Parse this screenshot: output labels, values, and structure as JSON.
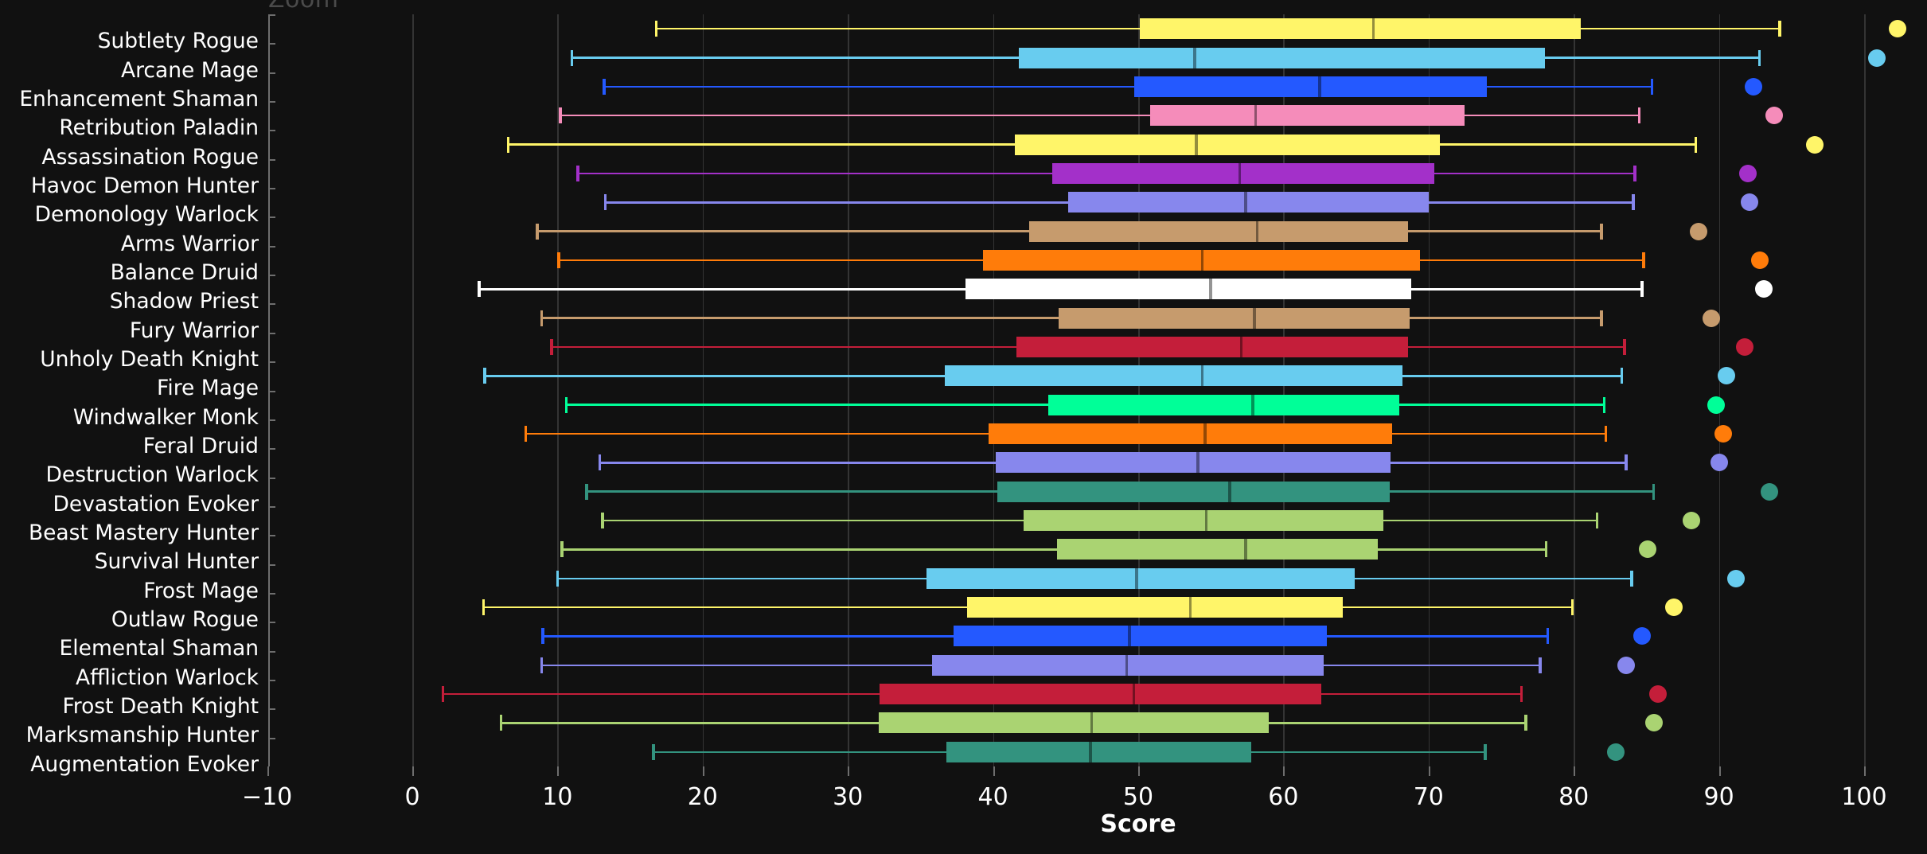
{
  "overlay": {
    "zoom_label": "Zoom"
  },
  "chart_data": {
    "type": "box",
    "title": "",
    "xlabel": "Score",
    "ylabel": "",
    "xlim": [
      -10,
      100
    ],
    "xticks": [
      -10,
      0,
      10,
      20,
      30,
      40,
      50,
      60,
      70,
      80,
      90,
      100
    ],
    "xticklabels": [
      "−10",
      "0",
      "10",
      "20",
      "30",
      "40",
      "50",
      "60",
      "70",
      "80",
      "90",
      "100"
    ],
    "grid": true,
    "grid_axis": "x",
    "legend": "none",
    "background": "#111111",
    "categories": [
      "Subtlety Rogue",
      "Arcane Mage",
      "Enhancement Shaman",
      "Retribution Paladin",
      "Assassination Rogue",
      "Havoc Demon Hunter",
      "Demonology Warlock",
      "Arms Warrior",
      "Balance Druid",
      "Shadow Priest",
      "Fury Warrior",
      "Unholy Death Knight",
      "Fire Mage",
      "Windwalker Monk",
      "Feral Druid",
      "Destruction Warlock",
      "Devastation Evoker",
      "Beast Mastery Hunter",
      "Survival Hunter",
      "Frost Mage",
      "Outlaw Rogue",
      "Elemental Shaman",
      "Affliction Warlock",
      "Frost Death Knight",
      "Marksmanship Hunter",
      "Augmentation Evoker"
    ],
    "boxes": [
      {
        "label": "Subtlety Rogue",
        "color": "#FFF569",
        "whisker_low": 16.8,
        "q1": 50.1,
        "median": 66.2,
        "q3": 80.5,
        "whisker_high": 94.2,
        "outliers": [
          102.3
        ]
      },
      {
        "label": "Arcane Mage",
        "color": "#68CCEF",
        "whisker_low": 11.0,
        "q1": 41.8,
        "median": 53.9,
        "q3": 78.0,
        "whisker_high": 92.8,
        "outliers": [
          100.9
        ]
      },
      {
        "label": "Enhancement Shaman",
        "color": "#2459FF",
        "whisker_low": 13.2,
        "q1": 49.7,
        "median": 62.5,
        "q3": 74.0,
        "whisker_high": 85.4,
        "outliers": [
          92.4
        ]
      },
      {
        "label": "Retribution Paladin",
        "color": "#F58CBA",
        "whisker_low": 10.2,
        "q1": 50.8,
        "median": 58.1,
        "q3": 72.5,
        "whisker_high": 84.5,
        "outliers": [
          93.8
        ]
      },
      {
        "label": "Assassination Rogue",
        "color": "#FFF569",
        "whisker_low": 6.6,
        "q1": 41.5,
        "median": 54.0,
        "q3": 70.8,
        "whisker_high": 88.4,
        "outliers": [
          96.6
        ]
      },
      {
        "label": "Havoc Demon Hunter",
        "color": "#A330C9",
        "whisker_low": 11.4,
        "q1": 44.1,
        "median": 57.0,
        "q3": 70.4,
        "whisker_high": 84.2,
        "outliers": [
          92.0
        ]
      },
      {
        "label": "Demonology Warlock",
        "color": "#8787ED",
        "whisker_low": 13.3,
        "q1": 45.2,
        "median": 57.4,
        "q3": 70.0,
        "whisker_high": 84.1,
        "outliers": [
          92.1
        ]
      },
      {
        "label": "Arms Warrior",
        "color": "#C69B6D",
        "whisker_low": 8.6,
        "q1": 42.5,
        "median": 58.2,
        "q3": 68.6,
        "whisker_high": 81.9,
        "outliers": [
          88.6
        ]
      },
      {
        "label": "Balance Druid",
        "color": "#FF7C0A",
        "whisker_low": 10.1,
        "q1": 39.3,
        "median": 54.4,
        "q3": 69.4,
        "whisker_high": 84.8,
        "outliers": [
          92.8
        ]
      },
      {
        "label": "Shadow Priest",
        "color": "#FFFFFF",
        "whisker_low": 4.6,
        "q1": 38.1,
        "median": 55.0,
        "q3": 68.8,
        "whisker_high": 84.7,
        "outliers": [
          93.1
        ]
      },
      {
        "label": "Fury Warrior",
        "color": "#C69B6D",
        "whisker_low": 8.9,
        "q1": 44.5,
        "median": 58.0,
        "q3": 68.7,
        "whisker_high": 81.9,
        "outliers": [
          89.5
        ]
      },
      {
        "label": "Unholy Death Knight",
        "color": "#C41E3A",
        "whisker_low": 9.6,
        "q1": 41.6,
        "median": 57.1,
        "q3": 68.6,
        "whisker_high": 83.5,
        "outliers": [
          91.8
        ]
      },
      {
        "label": "Fire Mage",
        "color": "#68CCEF",
        "whisker_low": 5.0,
        "q1": 36.7,
        "median": 54.4,
        "q3": 68.2,
        "whisker_high": 83.3,
        "outliers": [
          90.5
        ]
      },
      {
        "label": "Windwalker Monk",
        "color": "#00FF98",
        "whisker_low": 10.6,
        "q1": 43.8,
        "median": 57.9,
        "q3": 68.0,
        "whisker_high": 82.1,
        "outliers": [
          89.8
        ]
      },
      {
        "label": "Feral Druid",
        "color": "#FF7C0A",
        "whisker_low": 7.8,
        "q1": 39.7,
        "median": 54.6,
        "q3": 67.5,
        "whisker_high": 82.2,
        "outliers": [
          90.3
        ]
      },
      {
        "label": "Destruction Warlock",
        "color": "#8787ED",
        "whisker_low": 12.9,
        "q1": 40.2,
        "median": 54.1,
        "q3": 67.4,
        "whisker_high": 83.6,
        "outliers": [
          90.0
        ]
      },
      {
        "label": "Devastation Evoker",
        "color": "#33937F",
        "whisker_low": 12.0,
        "q1": 40.3,
        "median": 56.3,
        "q3": 67.3,
        "whisker_high": 85.5,
        "outliers": [
          93.5
        ]
      },
      {
        "label": "Beast Mastery Hunter",
        "color": "#AAD372",
        "whisker_low": 13.1,
        "q1": 42.1,
        "median": 54.7,
        "q3": 66.9,
        "whisker_high": 81.6,
        "outliers": [
          88.1
        ]
      },
      {
        "label": "Survival Hunter",
        "color": "#AAD372",
        "whisker_low": 10.3,
        "q1": 44.4,
        "median": 57.4,
        "q3": 66.5,
        "whisker_high": 78.1,
        "outliers": [
          85.1
        ]
      },
      {
        "label": "Frost Mage",
        "color": "#68CCEF",
        "whisker_low": 10.0,
        "q1": 35.4,
        "median": 49.9,
        "q3": 64.9,
        "whisker_high": 84.0,
        "outliers": [
          91.2
        ]
      },
      {
        "label": "Outlaw Rogue",
        "color": "#FFF569",
        "whisker_low": 4.9,
        "q1": 38.2,
        "median": 53.6,
        "q3": 64.1,
        "whisker_high": 79.9,
        "outliers": [
          86.9
        ]
      },
      {
        "label": "Elemental Shaman",
        "color": "#2459FF",
        "whisker_low": 9.0,
        "q1": 37.3,
        "median": 49.4,
        "q3": 63.0,
        "whisker_high": 78.2,
        "outliers": [
          84.7
        ]
      },
      {
        "label": "Affliction Warlock",
        "color": "#8787ED",
        "whisker_low": 8.9,
        "q1": 35.8,
        "median": 49.2,
        "q3": 62.8,
        "whisker_high": 77.7,
        "outliers": [
          83.6
        ]
      },
      {
        "label": "Frost Death Knight",
        "color": "#C41E3A",
        "whisker_low": 2.1,
        "q1": 32.2,
        "median": 49.7,
        "q3": 62.6,
        "whisker_high": 76.4,
        "outliers": [
          85.8
        ]
      },
      {
        "label": "Marksmanship Hunter",
        "color": "#AAD372",
        "whisker_low": 6.1,
        "q1": 32.1,
        "median": 46.8,
        "q3": 59.0,
        "whisker_high": 76.7,
        "outliers": [
          85.5
        ]
      },
      {
        "label": "Augmentation Evoker",
        "color": "#33937F",
        "whisker_low": 16.6,
        "q1": 36.8,
        "median": 46.7,
        "q3": 57.8,
        "whisker_high": 73.9,
        "outliers": [
          82.9
        ]
      }
    ]
  }
}
